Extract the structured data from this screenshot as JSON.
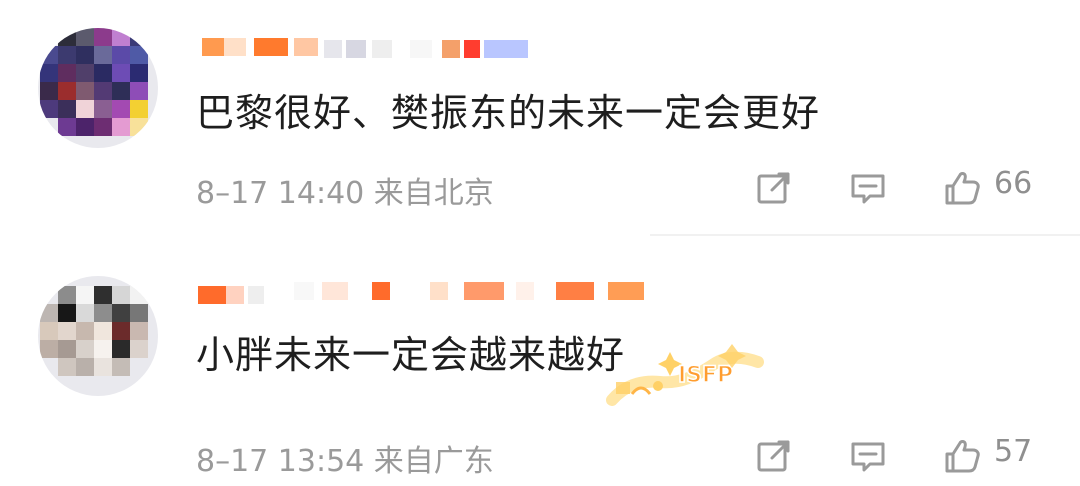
{
  "comments": [
    {
      "text": "巴黎很好、樊振东的未来一定会更好",
      "meta": "8–17 14:40 来自北京",
      "likes": "66"
    },
    {
      "text": "小胖未来一定会越来越好",
      "meta": "8–17 13:54 来自广东",
      "likes": "57"
    }
  ],
  "badge_text": "ISFP",
  "icons": {
    "share": "share-icon",
    "reply": "reply-icon",
    "like": "thumbs-up-icon"
  }
}
